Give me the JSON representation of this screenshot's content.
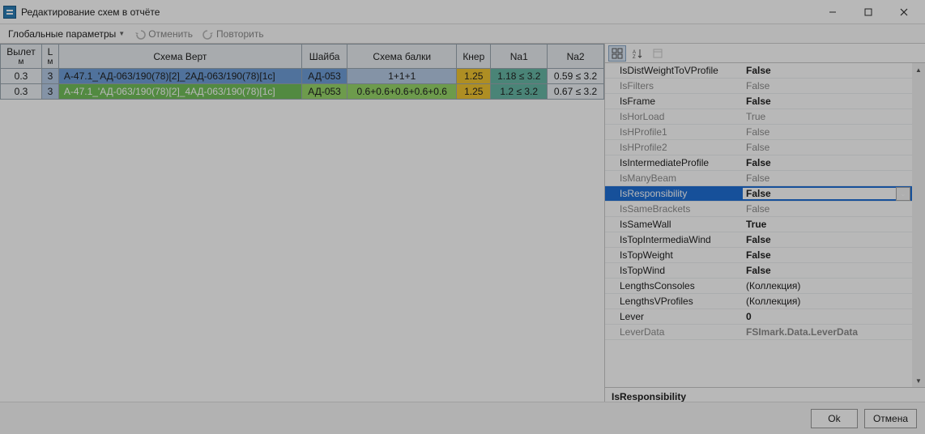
{
  "window": {
    "title": "Редактирование схем в отчёте"
  },
  "toolbar": {
    "global_params": "Глобальные параметры",
    "undo": "Отменить",
    "redo": "Повторить"
  },
  "grid": {
    "headers": {
      "vylet": "Вылет",
      "vylet_sub": "м",
      "L": "L",
      "L_sub": "м",
      "shema_vert": "Схема Верт",
      "shaiba": "Шайба",
      "shema_balki": "Схема балки",
      "kner": "Кнер",
      "na1": "Na1",
      "na2": "Na2"
    },
    "rows": [
      {
        "vylet": "0.3",
        "L": "3",
        "shema_vert": "А-47.1_'АД-063/190(78)[2]_2АД-063/190(78)[1с]",
        "shaiba": "АД-053",
        "shema_balki": "1+1+1",
        "kner": "1.25",
        "na1": "1.18 ≤ 3.2",
        "na2": "0.59 ≤ 3.2"
      },
      {
        "vylet": "0.3",
        "L": "3",
        "shema_vert": "А-47.1_'АД-063/190(78)[2]_4АД-063/190(78)[1с]",
        "shaiba": "АД-053",
        "shema_balki": "0.6+0.6+0.6+0.6+0.6",
        "kner": "1.25",
        "na1": "1.2 ≤ 3.2",
        "na2": "0.67 ≤ 3.2"
      }
    ]
  },
  "props": [
    {
      "name": "IsDistWeightToVProfile",
      "value": "False",
      "bold": true
    },
    {
      "name": "IsFilters",
      "value": "False",
      "dim": true
    },
    {
      "name": "IsFrame",
      "value": "False",
      "bold": true
    },
    {
      "name": "IsHorLoad",
      "value": "True",
      "dim": true
    },
    {
      "name": "IsHProfile1",
      "value": "False",
      "dim": true
    },
    {
      "name": "IsHProfile2",
      "value": "False",
      "dim": true
    },
    {
      "name": "IsIntermediateProfile",
      "value": "False",
      "bold": true
    },
    {
      "name": "IsManyBeam",
      "value": "False",
      "dim": true
    },
    {
      "name": "IsResponsibility",
      "value": "False",
      "sel": true
    },
    {
      "name": "IsSameBrackets",
      "value": "False",
      "dim": true
    },
    {
      "name": "IsSameWall",
      "value": "True",
      "bold": true
    },
    {
      "name": "IsTopIntermediaWind",
      "value": "False",
      "bold": true
    },
    {
      "name": "IsTopWeight",
      "value": "False",
      "bold": true
    },
    {
      "name": "IsTopWind",
      "value": "False",
      "bold": true
    },
    {
      "name": "LengthsConsoles",
      "value": "(Коллекция)"
    },
    {
      "name": "LengthsVProfiles",
      "value": "(Коллекция)"
    },
    {
      "name": "Lever",
      "value": "0",
      "bold": true
    },
    {
      "name": "LeverData",
      "value": "FSImark.Data.LeverData",
      "dim": true,
      "boldval": true
    }
  ],
  "desc": {
    "title": "IsResponsibility"
  },
  "footer": {
    "ok": "Ok",
    "cancel": "Отмена"
  }
}
